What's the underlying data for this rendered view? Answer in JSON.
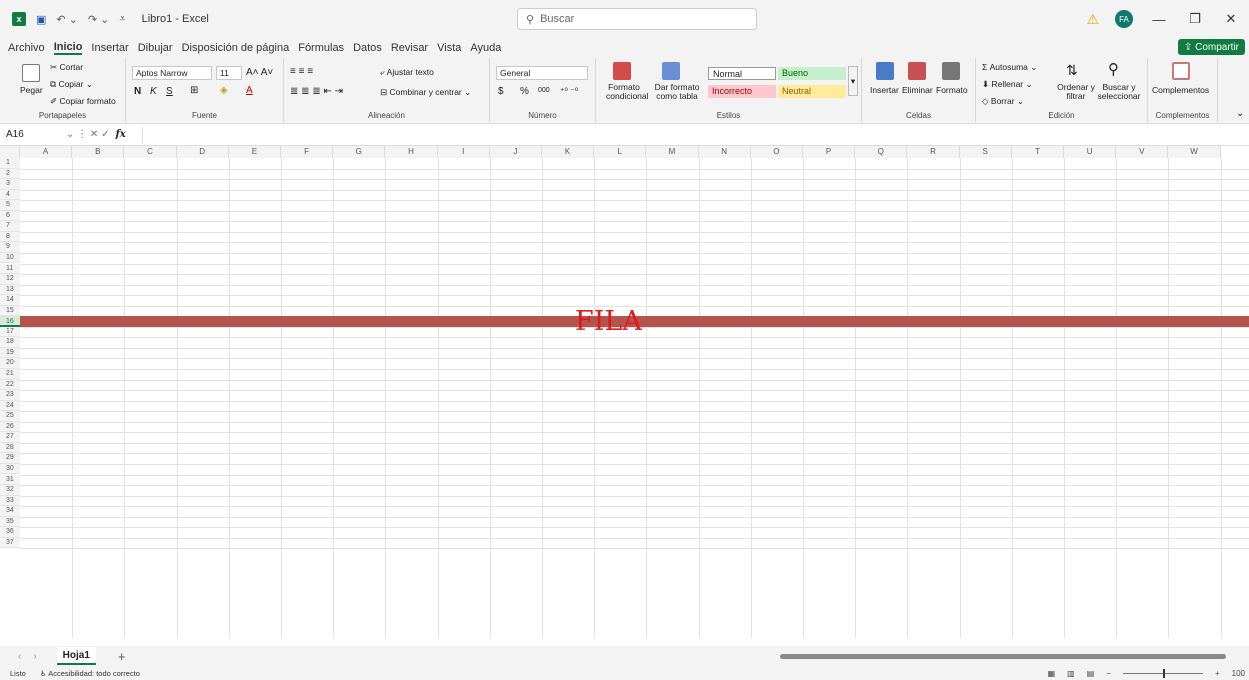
{
  "app": {
    "title": "Libro1 - Excel",
    "search_placeholder": "Buscar",
    "avatar_initials": "FA"
  },
  "menu": {
    "items": [
      "Archivo",
      "Inicio",
      "Insertar",
      "Dibujar",
      "Disposición de página",
      "Fórmulas",
      "Datos",
      "Revisar",
      "Vista",
      "Ayuda"
    ],
    "active": "Inicio",
    "share": "Compartir"
  },
  "ribbon": {
    "clipboard": {
      "paste": "Pegar",
      "cut": "Cortar",
      "copy": "Copiar",
      "format_painter": "Copiar formato",
      "label": "Portapapeles"
    },
    "font": {
      "name": "Aptos Narrow",
      "size": "11",
      "bold": "N",
      "italic": "K",
      "underline": "S",
      "label": "Fuente"
    },
    "alignment": {
      "wrap": "Ajustar texto",
      "merge": "Combinar y centrar",
      "label": "Alineación"
    },
    "number": {
      "format": "General",
      "currency": "$",
      "percent": "%",
      "thousands": "000",
      "label": "Número"
    },
    "styles": {
      "conditional": "Formato condicional",
      "as_table": "Dar formato como tabla",
      "normal": "Normal",
      "good": "Bueno",
      "bad": "Incorrecto",
      "neutral": "Neutral",
      "label": "Estilos"
    },
    "cells": {
      "insert": "Insertar",
      "delete": "Eliminar",
      "format": "Formato",
      "label": "Celdas"
    },
    "editing": {
      "autosum": "Autosuma",
      "fill": "Rellenar",
      "clear": "Borrar",
      "sort": "Ordenar y filtrar",
      "find": "Buscar y seleccionar",
      "label": "Edición"
    },
    "addins": {
      "button": "Complementos",
      "label": "Complementos"
    }
  },
  "formula_bar": {
    "name_box": "A16",
    "fx": "fx"
  },
  "grid": {
    "columns": [
      "A",
      "B",
      "C",
      "D",
      "E",
      "F",
      "G",
      "H",
      "I",
      "J",
      "K",
      "L",
      "M",
      "N",
      "O",
      "P",
      "Q",
      "R",
      "S",
      "T",
      "U",
      "V",
      "W"
    ],
    "rows": [
      "1",
      "2",
      "3",
      "4",
      "5",
      "6",
      "7",
      "8",
      "9",
      "10",
      "11",
      "12",
      "13",
      "14",
      "15",
      "16",
      "17",
      "18",
      "19",
      "20",
      "21",
      "22",
      "23",
      "24",
      "25",
      "26",
      "27",
      "28",
      "29",
      "30",
      "31",
      "32",
      "33",
      "34",
      "35",
      "36",
      "37"
    ],
    "selected_row": "16",
    "annotation": "FILA",
    "highlight_color": "#b5544e",
    "annotation_color": "#e01919"
  },
  "sheets": {
    "tabs": [
      "Hoja1"
    ],
    "active": "Hoja1"
  },
  "status": {
    "ready": "Listo",
    "accessibility": "Accesibilidad: todo correcto",
    "zoom": "100"
  }
}
